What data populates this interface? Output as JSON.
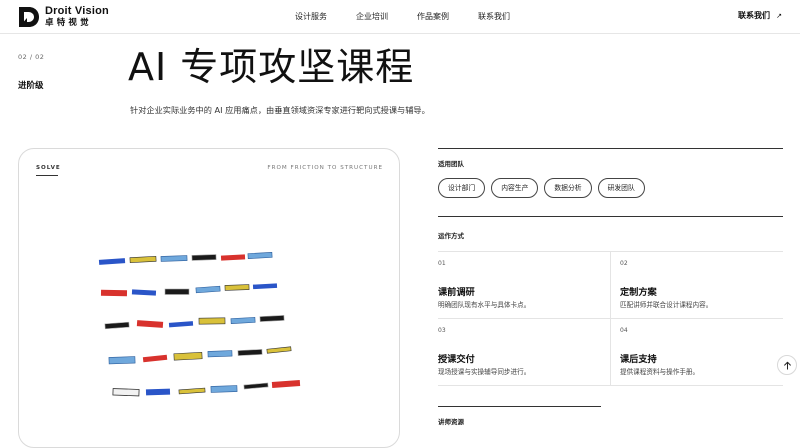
{
  "header": {
    "brand_en": "Droit Vision",
    "brand_cn": "卓特视觉",
    "nav": [
      "设计服务",
      "企业培训",
      "作品案例",
      "联系我们"
    ],
    "cta": "联系我们"
  },
  "meta": {
    "page": "02 / 02",
    "level": "进阶级"
  },
  "hero": {
    "title": "AI 专项攻坚课程",
    "subtitle": "针对企业实际业务中的 AI 应用痛点，由垂直领域资深专家进行靶向式授课与辅导。"
  },
  "card": {
    "tab": "SOLVE",
    "caption": "FROM FRICTION TO STRUCTURE"
  },
  "teams": {
    "label": "适用团队",
    "chips": [
      "设计部门",
      "内容生产",
      "数据分析",
      "研发团队"
    ]
  },
  "workflow": {
    "label": "运作方式",
    "steps": [
      {
        "num": "01",
        "title": "课前调研",
        "desc": "明确团队现有水平与具体卡点。"
      },
      {
        "num": "02",
        "title": "定制方案",
        "desc": "匹配讲师并联合设计课程内容。"
      },
      {
        "num": "03",
        "title": "授课交付",
        "desc": "现场授课与实操辅导同步进行。"
      },
      {
        "num": "04",
        "title": "课后支持",
        "desc": "提供课程资料与操作手册。"
      }
    ]
  },
  "resources": {
    "label": "讲师资源"
  },
  "colors": {
    "blue": "#2a55c8",
    "yellow": "#d9c13a",
    "light_blue": "#6fa8dc",
    "black": "#1a1a1a",
    "red": "#d8322d",
    "white": "#f2f2f2"
  },
  "icons": {
    "scroll_top": "arrow-up-icon",
    "cta": "arrow-up-right-icon"
  }
}
